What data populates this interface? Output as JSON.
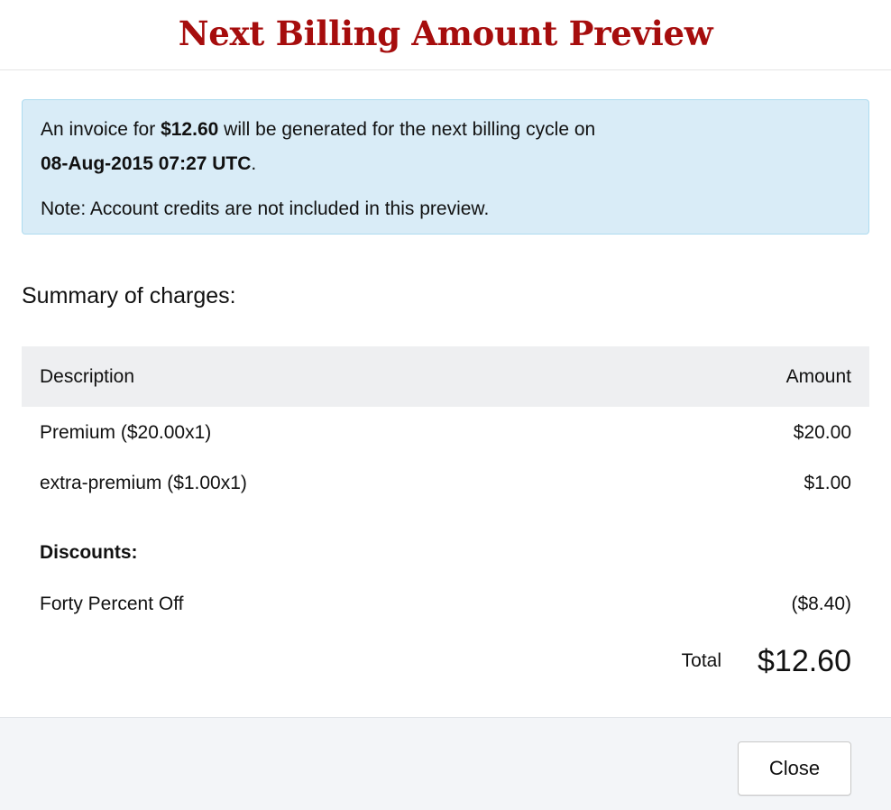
{
  "header": {
    "title": "Next Billing Amount Preview"
  },
  "alert": {
    "prefix": "An invoice for ",
    "amount": "$12.60",
    "middle": " will be generated for the next billing cycle on",
    "date": "08-Aug-2015 07:27 UTC",
    "suffix": ".",
    "note": "Note: Account credits are not included in this preview."
  },
  "summary": {
    "label": "Summary of charges:"
  },
  "table": {
    "columns": {
      "description": "Description",
      "amount": "Amount"
    },
    "items": [
      {
        "description": "Premium ($20.00x1)",
        "amount": "$20.00"
      },
      {
        "description": "extra-premium ($1.00x1)",
        "amount": "$1.00"
      }
    ],
    "discounts_label": "Discounts:",
    "discounts": [
      {
        "description": "Forty Percent Off",
        "amount": "($8.40)"
      }
    ],
    "total_label": "Total",
    "total_value": "$12.60"
  },
  "footer": {
    "close_label": "Close"
  },
  "colors": {
    "title": "#a60d0d",
    "alert_bg": "#d9ecf7",
    "alert_border": "#aedbef",
    "table_header_bg": "#eeeff1",
    "footer_bg": "#f3f5f8"
  }
}
